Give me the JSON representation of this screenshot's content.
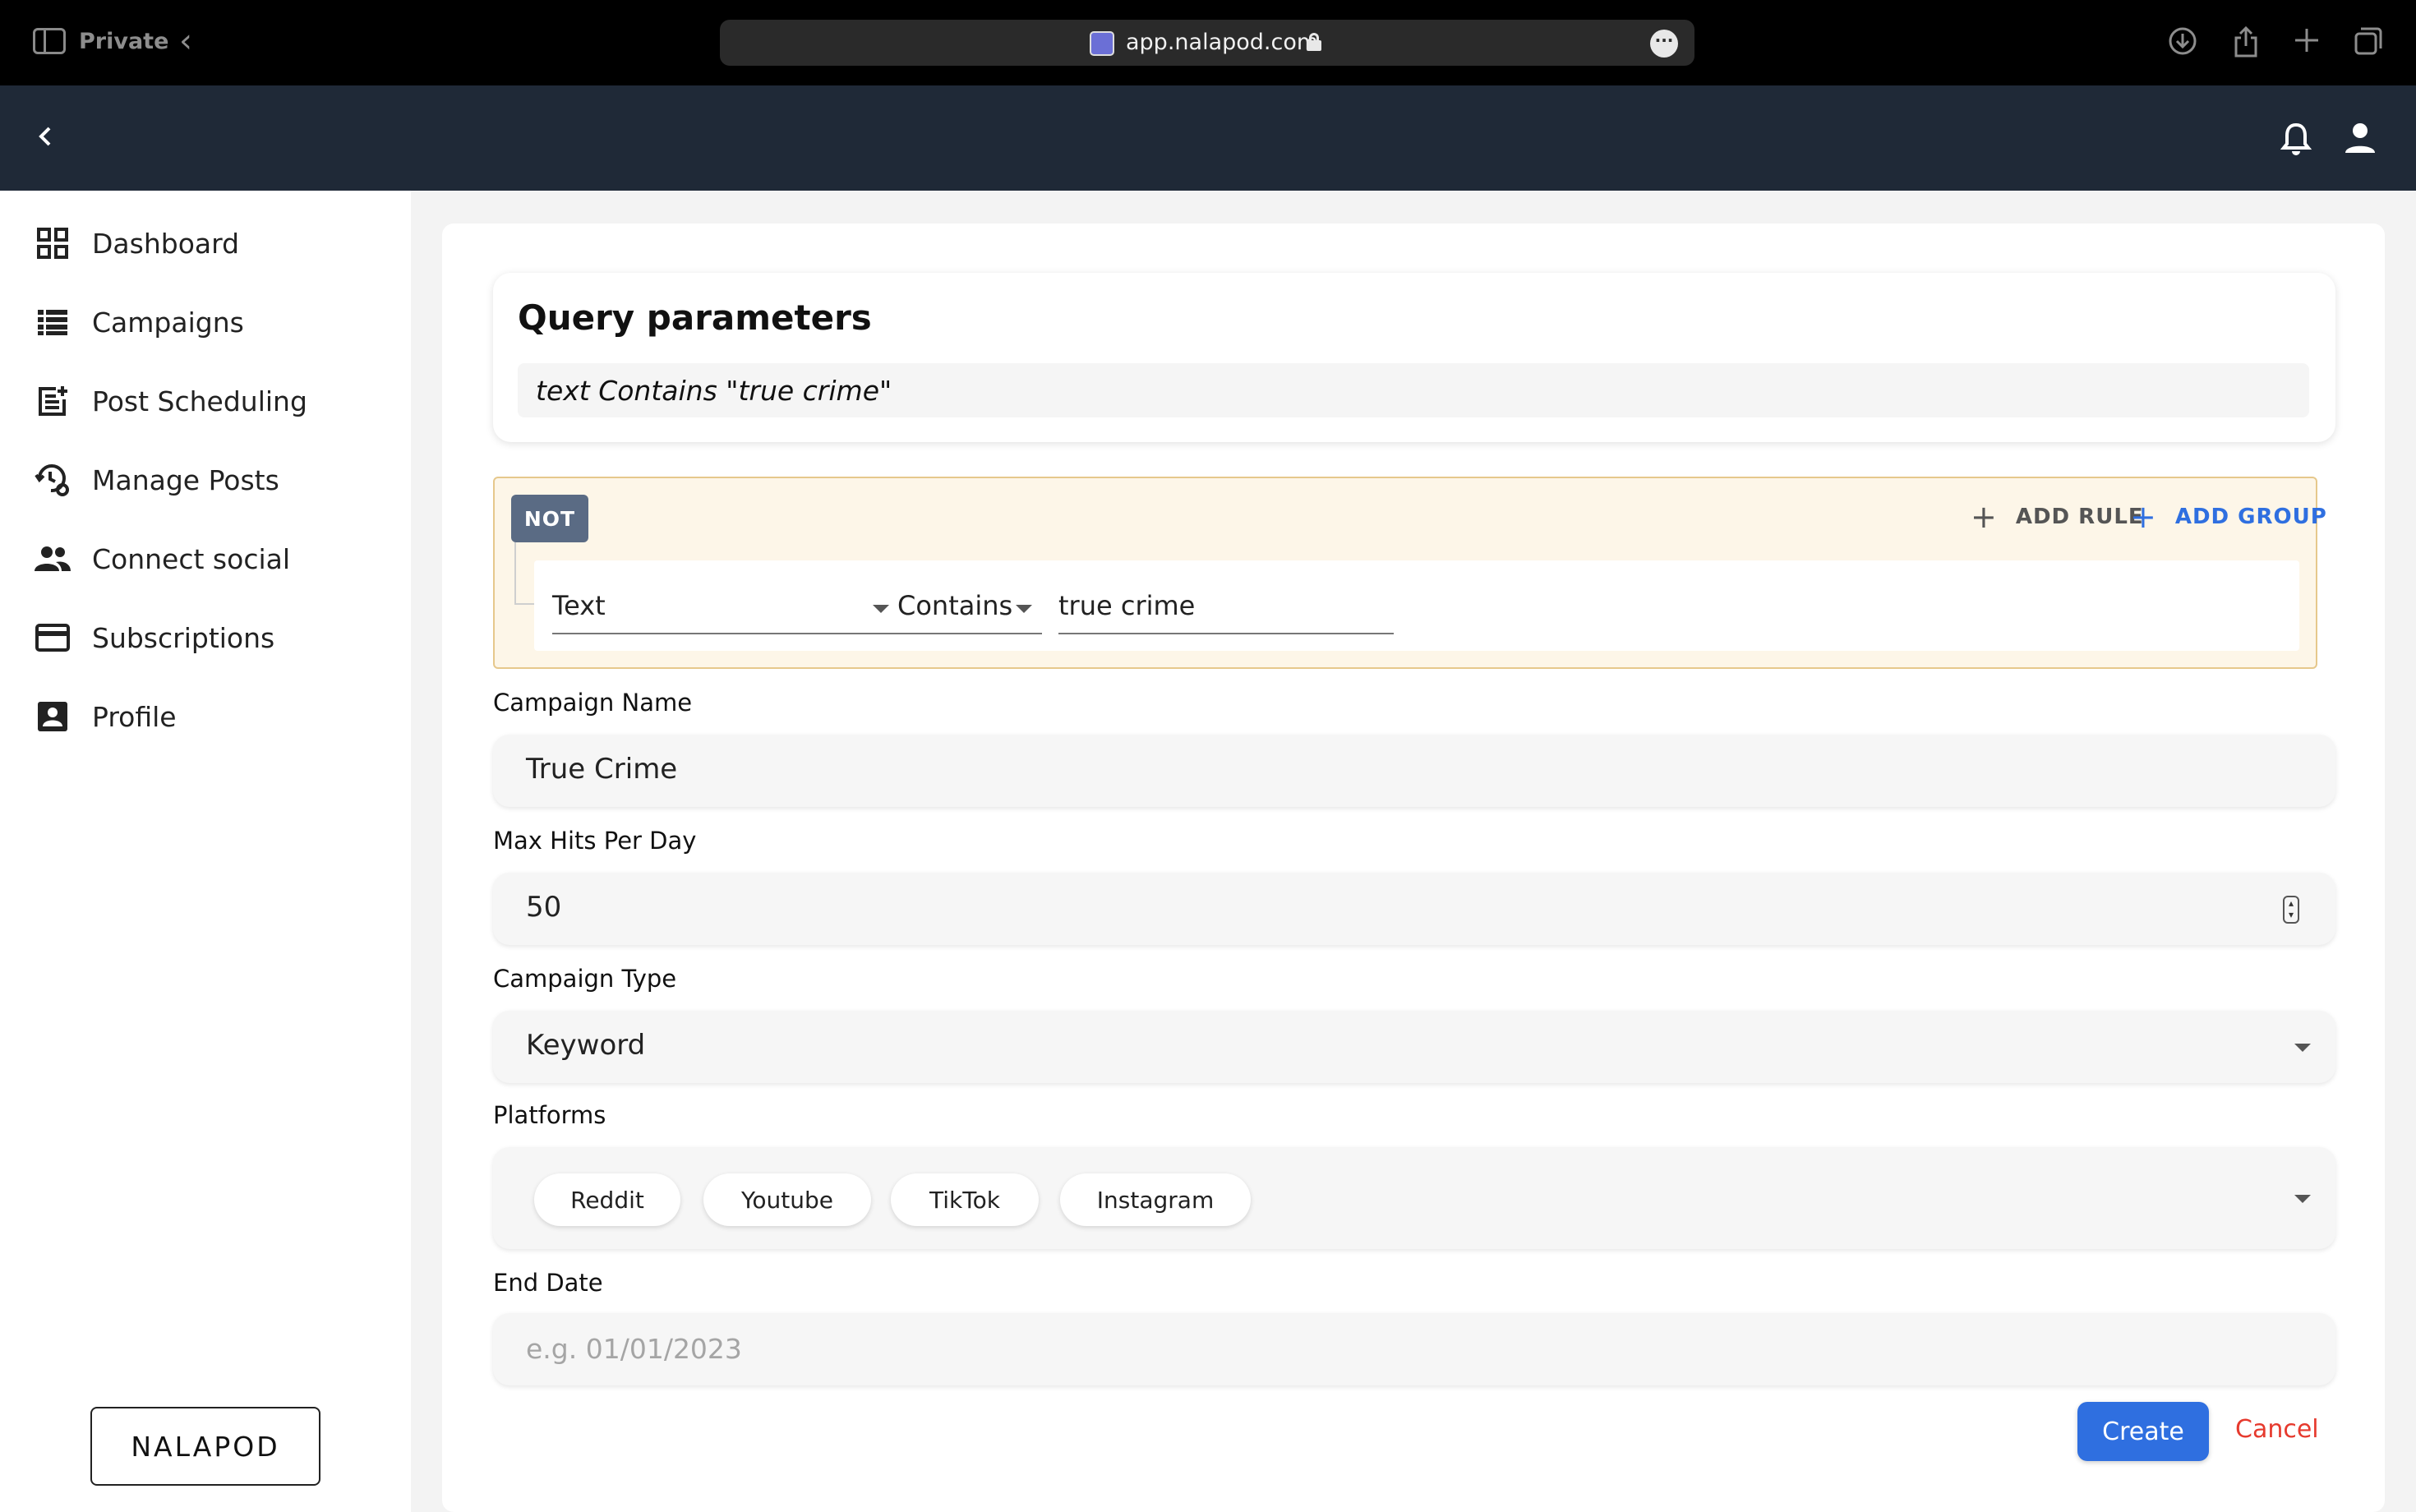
{
  "browser": {
    "private_label": "Private",
    "url": "app.nalapod.com"
  },
  "sidebar": {
    "items": [
      {
        "label": "Dashboard",
        "icon": "dashboard-icon"
      },
      {
        "label": "Campaigns",
        "icon": "list-icon"
      },
      {
        "label": "Post Scheduling",
        "icon": "post-add-icon"
      },
      {
        "label": "Manage Posts",
        "icon": "history-settings-icon"
      },
      {
        "label": "Connect social",
        "icon": "people-icon"
      },
      {
        "label": "Subscriptions",
        "icon": "credit-card-icon"
      },
      {
        "label": "Profile",
        "icon": "account-box-icon"
      }
    ],
    "brand_button": "NALAPOD"
  },
  "query": {
    "title": "Query parameters",
    "expression": "text Contains \"true crime\""
  },
  "rule_group": {
    "not_label": "NOT",
    "add_rule_label": "ADD RULE",
    "add_group_label": "ADD GROUP",
    "rule": {
      "field": "Text",
      "operator": "Contains",
      "value": "true crime"
    },
    "colors": {
      "background": "#fdf6e8",
      "border": "#e6c88c",
      "not_button": "#5a6b84",
      "add_group": "#2f6fe0",
      "add_rule": "#555555"
    }
  },
  "form": {
    "campaign_name": {
      "label": "Campaign Name",
      "value": "True Crime"
    },
    "max_hits": {
      "label": "Max Hits Per Day",
      "value": "50"
    },
    "campaign_type": {
      "label": "Campaign Type",
      "value": "Keyword"
    },
    "platforms": {
      "label": "Platforms",
      "chips": [
        "Reddit",
        "Youtube",
        "TikTok",
        "Instagram"
      ]
    },
    "end_date": {
      "label": "End Date",
      "placeholder": "e.g. 01/01/2023"
    }
  },
  "actions": {
    "create_label": "Create",
    "cancel_label": "Cancel",
    "colors": {
      "create": "#2f6fe0",
      "cancel": "#e63a2e"
    }
  },
  "theme": {
    "appbar": "#1f2937",
    "chrome": "#000000"
  }
}
